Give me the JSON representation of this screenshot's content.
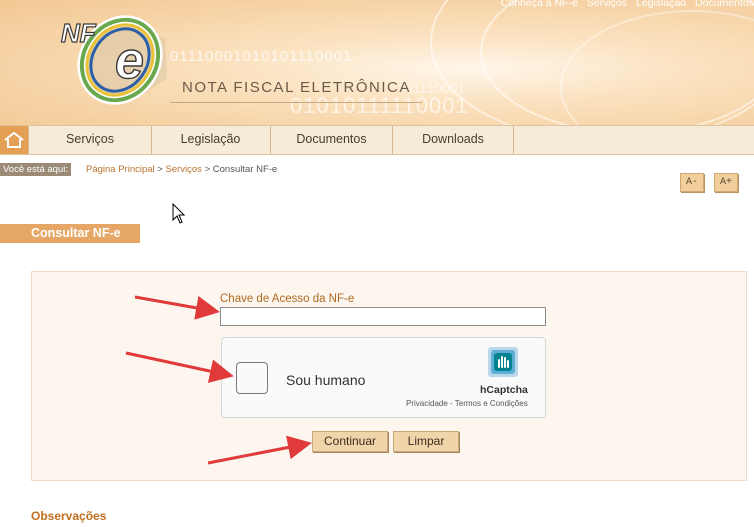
{
  "header": {
    "top_links": [
      "Conheça a NF-e",
      "Serviços",
      "Legislação",
      "Documentos"
    ],
    "title": "NOTA FISCAL ELETRÔNICA",
    "logo_text": "NF-e",
    "binary_1": "01110001010101110001",
    "binary_2": "01010111110001",
    "binary_3": "01110001"
  },
  "nav": {
    "items": [
      {
        "label": "Serviços"
      },
      {
        "label": "Legislação"
      },
      {
        "label": "Documentos"
      },
      {
        "label": "Downloads"
      }
    ]
  },
  "breadcrumb": {
    "prefix": "Você está aqui:",
    "home": "Página Principal",
    "sep1": ">",
    "services": "Serviços",
    "sep2": ">",
    "current": "Consultar NF-e"
  },
  "font_controls": {
    "decrease": "A-",
    "increase": "A+"
  },
  "page": {
    "section_title": "Consultar NF-e"
  },
  "form": {
    "chave_label": "Chave de Acesso da NF-e",
    "chave_value": "",
    "captcha_label": "Sou humano",
    "captcha_brand": "hCaptcha",
    "captcha_links": "Privacidade - Termos e Condições",
    "submit_label": "Continuar",
    "clear_label": "Limpar"
  },
  "observacoes": "Observações",
  "colors": {
    "accent": "#e6a766",
    "link": "#b8732e",
    "annotation_arrow": "#e03a3a"
  }
}
